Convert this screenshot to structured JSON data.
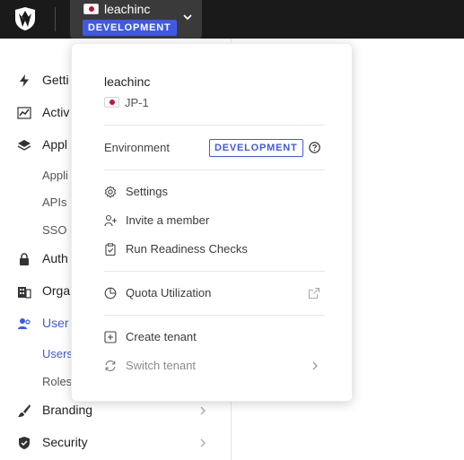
{
  "topbar": {
    "tenant_name": "leachinc",
    "environment_badge": "DEVELOPMENT"
  },
  "sidebar": {
    "items": [
      {
        "label": "Getti",
        "icon": "bolt-icon"
      },
      {
        "label": "Activ",
        "icon": "activity-icon"
      },
      {
        "label": "Appl",
        "icon": "layers-icon"
      },
      {
        "label": "Appli",
        "sub": true
      },
      {
        "label": "APIs",
        "sub": true
      },
      {
        "label": "SSO",
        "sub": true
      },
      {
        "label": "Auth",
        "icon": "lock-icon"
      },
      {
        "label": "Orga",
        "icon": "building-icon"
      },
      {
        "label": "User",
        "icon": "users-icon",
        "active": true
      },
      {
        "label": "Users",
        "sub": true,
        "active": true
      },
      {
        "label": "Roles",
        "sub": true
      },
      {
        "label": "Branding",
        "icon": "brush-icon"
      },
      {
        "label": "Security",
        "icon": "shield-icon"
      }
    ],
    "accent_color": "#3f59e4"
  },
  "dropdown": {
    "tenant_name": "leachinc",
    "region": "JP-1",
    "environment_label": "Environment",
    "environment_value": "DEVELOPMENT",
    "menu": [
      {
        "label": "Settings",
        "icon": "gear-icon"
      },
      {
        "label": "Invite a member",
        "icon": "user-plus-icon"
      },
      {
        "label": "Run Readiness Checks",
        "icon": "clipboard-check-icon"
      },
      {
        "label": "Quota Utilization",
        "icon": "pie-chart-icon",
        "right_icon": "external-link-icon"
      },
      {
        "label": "Create tenant",
        "icon": "plus-square-icon"
      },
      {
        "label": "Switch tenant",
        "icon": "switch-icon",
        "right_icon": "chevron-right-icon"
      }
    ]
  }
}
